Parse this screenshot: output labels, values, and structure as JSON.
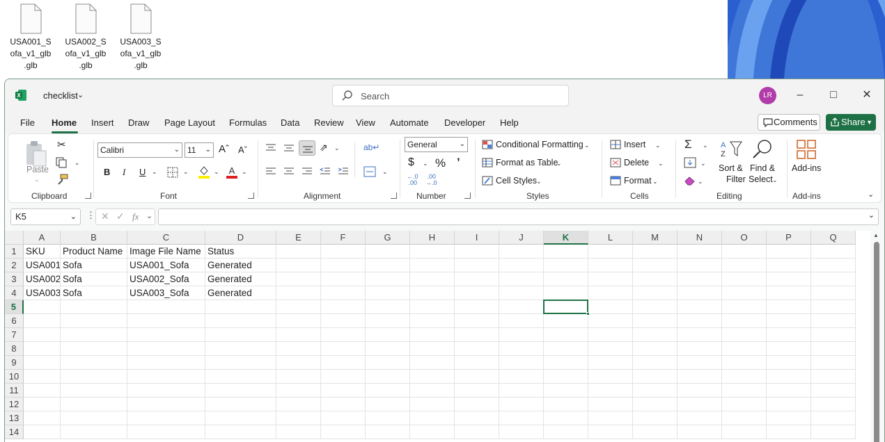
{
  "desktop": {
    "files": [
      {
        "label": "USA001_S\nofa_v1_glb\n.glb"
      },
      {
        "label": "USA002_S\nofa_v1_glb\n.glb"
      },
      {
        "label": "USA003_S\nofa_v1_glb\n.glb"
      }
    ]
  },
  "window": {
    "title": "checklist",
    "search_placeholder": "Search",
    "avatar_initials": "LR"
  },
  "menu": {
    "tabs": [
      "File",
      "Home",
      "Insert",
      "Draw",
      "Page Layout",
      "Formulas",
      "Data",
      "Review",
      "View",
      "Automate",
      "Developer",
      "Help"
    ],
    "active": "Home",
    "comments_label": "Comments",
    "share_label": "Share"
  },
  "ribbon": {
    "clipboard": {
      "label": "Clipboard",
      "paste": "Paste"
    },
    "font": {
      "label": "Font",
      "name": "Calibri",
      "size": "11"
    },
    "alignment": {
      "label": "Alignment"
    },
    "number": {
      "label": "Number",
      "format": "General"
    },
    "styles": {
      "label": "Styles",
      "conditional": "Conditional Formatting",
      "table": "Format as Table",
      "cell_styles": "Cell Styles"
    },
    "cells": {
      "label": "Cells",
      "insert": "Insert",
      "delete": "Delete",
      "format": "Format"
    },
    "editing": {
      "label": "Editing",
      "sort1": "Sort &",
      "sort2": "Filter",
      "find1": "Find &",
      "find2": "Select"
    },
    "addins": {
      "label": "Add-ins",
      "button": "Add-ins"
    }
  },
  "formula_bar": {
    "name_box": "K5",
    "fx": "fx",
    "content": ""
  },
  "sheet": {
    "columns": [
      "A",
      "B",
      "C",
      "D",
      "E",
      "F",
      "G",
      "H",
      "I",
      "J",
      "K",
      "L",
      "M",
      "N",
      "O",
      "P",
      "Q"
    ],
    "rows": [
      "1",
      "2",
      "3",
      "4",
      "5",
      "6",
      "7",
      "8",
      "9",
      "10",
      "11",
      "12",
      "13",
      "14"
    ],
    "selected": "K5",
    "cells": [
      [
        "SKU",
        "Product Name",
        "Image File Name",
        "Status"
      ],
      [
        "USA001",
        "Sofa",
        "USA001_Sofa",
        "Generated"
      ],
      [
        "USA002",
        "Sofa",
        "USA002_Sofa",
        "Generated"
      ],
      [
        "USA003",
        "Sofa",
        "USA003_Sofa",
        "Generated"
      ]
    ]
  },
  "colors": {
    "accent": "#1e7145",
    "avatar": "#b23ca9"
  }
}
